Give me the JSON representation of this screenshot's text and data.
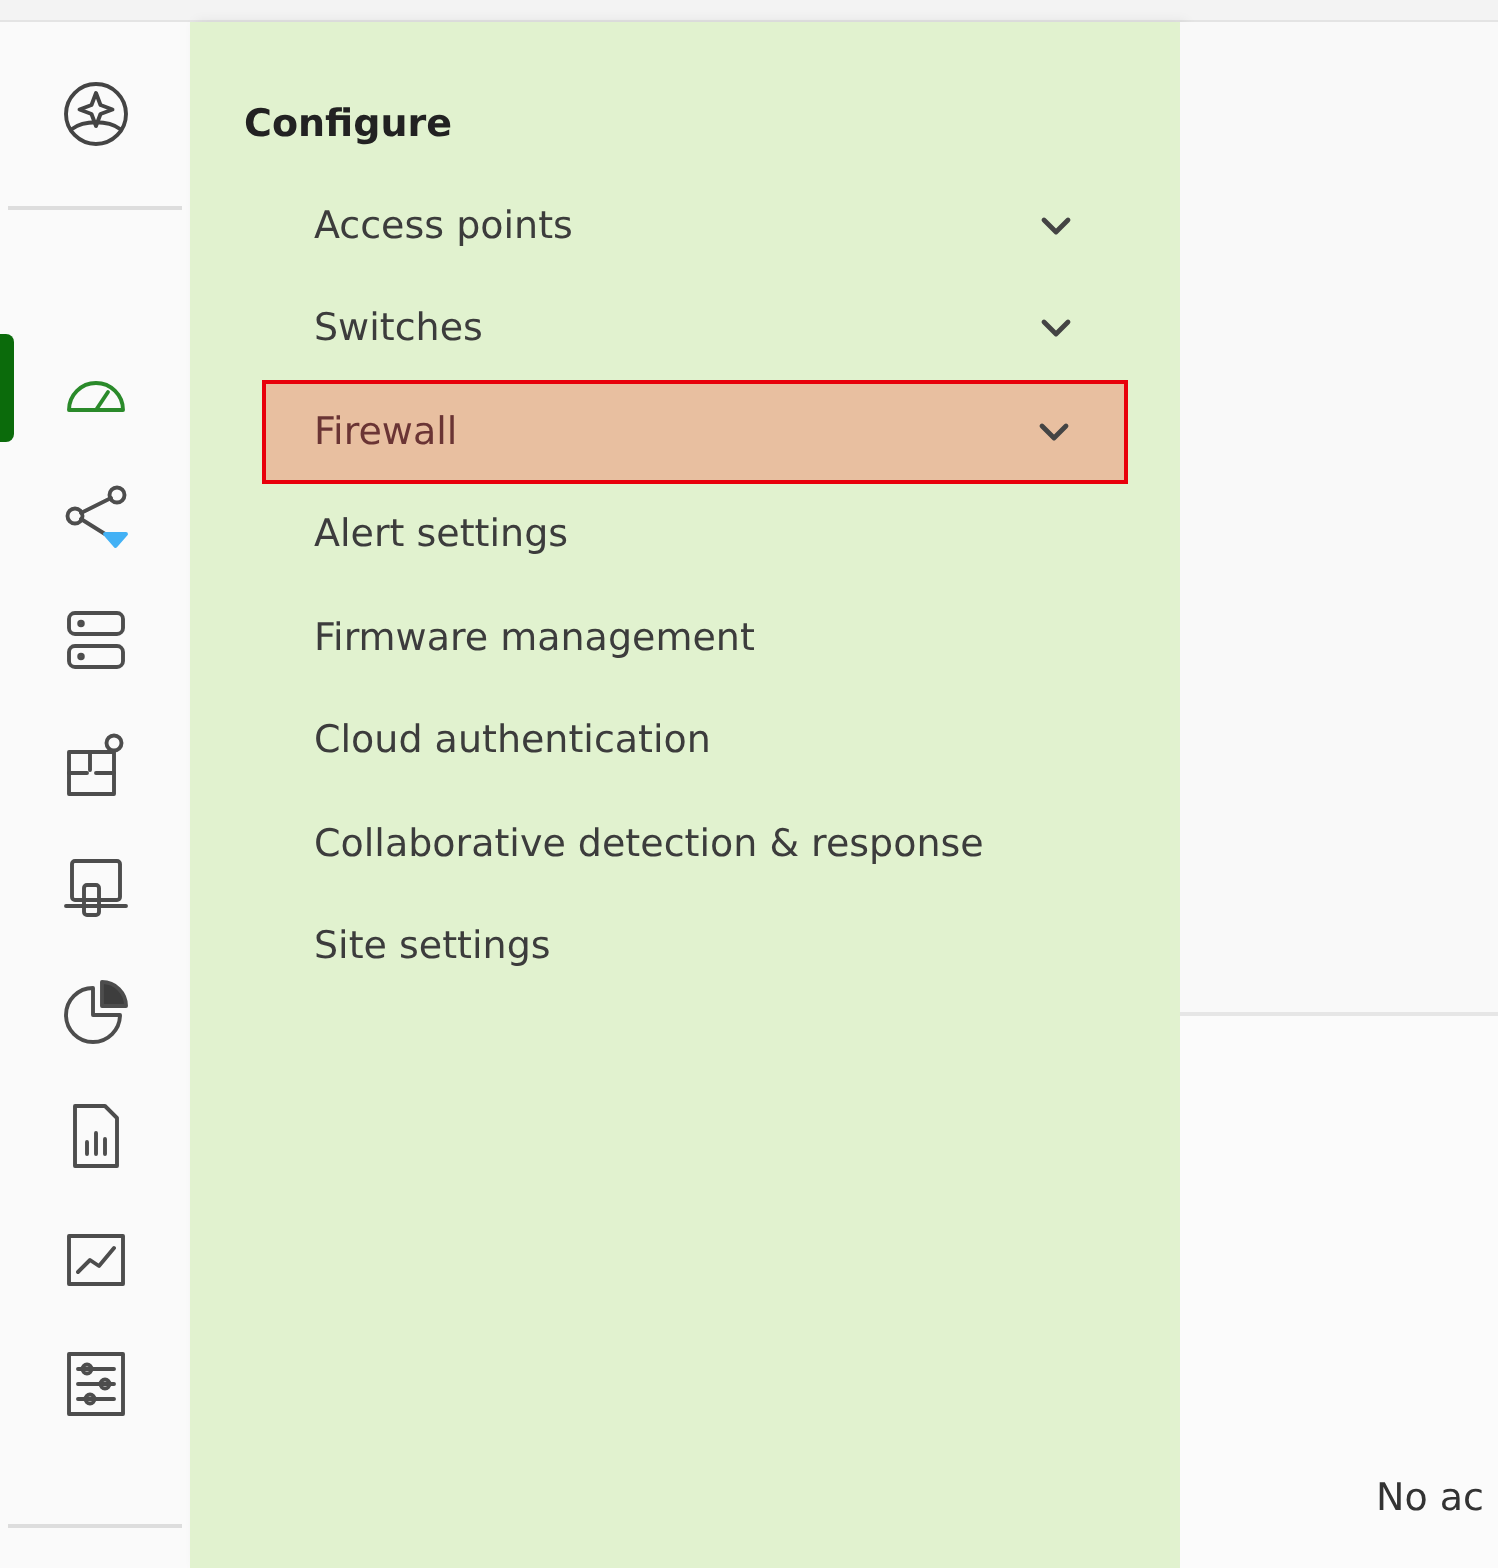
{
  "rail": {
    "items": [
      {
        "selected": true
      },
      {
        "selected": false
      },
      {
        "selected": false
      },
      {
        "selected": false
      },
      {
        "selected": false
      },
      {
        "selected": false
      },
      {
        "selected": false
      },
      {
        "selected": false
      },
      {
        "selected": false
      }
    ]
  },
  "menu": {
    "title": "Configure",
    "items": [
      {
        "label": "Access points",
        "expandable": true,
        "highlighted": false
      },
      {
        "label": "Switches",
        "expandable": true,
        "highlighted": false
      },
      {
        "label": "Firewall",
        "expandable": true,
        "highlighted": true
      },
      {
        "label": "Alert settings",
        "expandable": false,
        "highlighted": false
      },
      {
        "label": "Firmware management",
        "expandable": false,
        "highlighted": false
      },
      {
        "label": "Cloud authentication",
        "expandable": false,
        "highlighted": false
      },
      {
        "label": "Collaborative detection & response",
        "expandable": false,
        "highlighted": false
      },
      {
        "label": "Site settings",
        "expandable": false,
        "highlighted": false
      }
    ]
  },
  "content": {
    "empty_text": "No ac"
  }
}
